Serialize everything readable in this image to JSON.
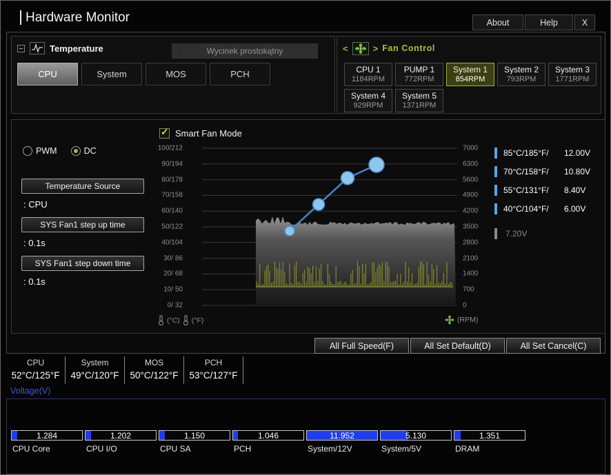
{
  "window": {
    "title": "Hardware Monitor",
    "about": "About",
    "help": "Help",
    "close": "X"
  },
  "snip_overlay": {
    "label": "Wycinek prostokątny"
  },
  "temperature_panel": {
    "title": "Temperature",
    "selected_tab": "CPU",
    "tabs": [
      {
        "label": "CPU"
      },
      {
        "label": "System"
      },
      {
        "label": "MOS"
      },
      {
        "label": "PCH"
      }
    ]
  },
  "fan_control": {
    "title": "Fan Control",
    "prev_arrow": "<",
    "next_arrow": ">",
    "selected_fan": "System 1",
    "fans": [
      {
        "name": "CPU 1",
        "rpm": "1184RPM"
      },
      {
        "name": "PUMP 1",
        "rpm": "772RPM"
      },
      {
        "name": "System 1",
        "rpm": "854RPM"
      },
      {
        "name": "System 2",
        "rpm": "793RPM"
      },
      {
        "name": "System 3",
        "rpm": "1771RPM"
      },
      {
        "name": "System 4",
        "rpm": "929RPM"
      },
      {
        "name": "System 5",
        "rpm": "1371RPM"
      }
    ]
  },
  "fan_settings": {
    "pwm_label": "PWM",
    "dc_label": "DC",
    "mode": "DC",
    "controls": [
      {
        "label": "Temperature Source",
        "value": ": CPU"
      },
      {
        "label": "SYS Fan1 step up time",
        "value": ": 0.1s"
      },
      {
        "label": "SYS Fan1 step down time",
        "value": ": 0.1s"
      }
    ]
  },
  "smart_fan": {
    "checkbox_label": "Smart Fan Mode",
    "checked": true,
    "left_axis": [
      "100/212",
      "90/194",
      "80/178",
      "70/158",
      "60/140",
      "50/122",
      "40/104",
      "30/ 86",
      "20/ 68",
      "10/ 50",
      "0/ 32"
    ],
    "right_axis": [
      "7000",
      "6300",
      "5600",
      "4900",
      "4200",
      "3500",
      "2800",
      "2100",
      "1400",
      "700",
      "0"
    ],
    "celsius_label": "(°C)",
    "fahrenheit_label": "(°F)",
    "rpm_label": "(RPM)"
  },
  "legend": [
    {
      "temp": "85°C/185°F/",
      "volt": "12.00V",
      "active": true
    },
    {
      "temp": "70°C/158°F/",
      "volt": "10.80V",
      "active": true
    },
    {
      "temp": "55°C/131°F/",
      "volt": "8.40V",
      "active": true
    },
    {
      "temp": "40°C/104°F/",
      "volt": "6.00V",
      "active": true
    },
    {
      "temp": "",
      "volt": "7.20V",
      "active": false
    }
  ],
  "chart_data": {
    "type": "line",
    "title": "Smart Fan Mode",
    "xlabel": "Temperature (°C / °F)",
    "ylabel_left": "Temperature scale (°C/°F)",
    "ylabel_right": "Fan speed (RPM)",
    "y_left_ticks": [
      "100/212",
      "90/194",
      "80/178",
      "70/158",
      "60/140",
      "50/122",
      "40/104",
      "30/ 86",
      "20/ 68",
      "10/ 50",
      "0/ 32"
    ],
    "y_right_ticks": [
      7000,
      6300,
      5600,
      4900,
      4200,
      3500,
      2800,
      2100,
      1400,
      700,
      0
    ],
    "curve_points": [
      {
        "temp_c": 40,
        "voltage": 6.0
      },
      {
        "temp_c": 55,
        "voltage": 8.4
      },
      {
        "temp_c": 70,
        "voltage": 10.8
      },
      {
        "temp_c": 85,
        "voltage": 12.0
      }
    ],
    "history_series": [
      "fan-speed-gray-area ~3400RPM",
      "pwm-duty-yellow-spikes"
    ],
    "grid": true,
    "legend_position": "right"
  },
  "action_buttons": [
    {
      "label": "All Full Speed(F)"
    },
    {
      "label": "All Set Default(D)"
    },
    {
      "label": "All Set Cancel(C)"
    }
  ],
  "temperatures": [
    {
      "name": "CPU",
      "value": "52°C/125°F"
    },
    {
      "name": "System",
      "value": "49°C/120°F"
    },
    {
      "name": "MOS",
      "value": "50°C/122°F"
    },
    {
      "name": "PCH",
      "value": "53°C/127°F"
    }
  ],
  "voltage": {
    "title": "Voltage(V)",
    "items": [
      {
        "name": "CPU Core",
        "value": "1.284",
        "fill_pct": 8
      },
      {
        "name": "CPU I/O",
        "value": "1.202",
        "fill_pct": 8
      },
      {
        "name": "CPU SA",
        "value": "1.150",
        "fill_pct": 8
      },
      {
        "name": "PCH",
        "value": "1.046",
        "fill_pct": 7
      },
      {
        "name": "System/12V",
        "value": "11.952",
        "fill_pct": 100
      },
      {
        "name": "System/5V",
        "value": "5.130",
        "fill_pct": 38
      },
      {
        "name": "DRAM",
        "value": "1.351",
        "fill_pct": 9
      }
    ]
  }
}
